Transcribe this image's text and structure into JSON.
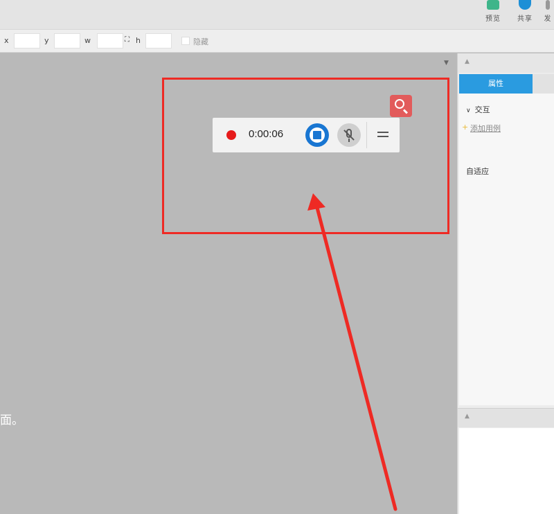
{
  "toolbar": {
    "preview_label": "预览",
    "share_label": "共享",
    "publish_label": "发"
  },
  "propbar": {
    "x_label": "x",
    "y_label": "y",
    "w_label": "w",
    "h_label": "h",
    "hidden_label": "隐藏"
  },
  "recorder": {
    "elapsed_time": "0:00:06"
  },
  "canvas": {
    "caption": "面。"
  },
  "inspector": {
    "tab_properties": "属性",
    "section_interaction": "交互",
    "add_case_link": "添加用例",
    "adaptive_label": "自适应"
  },
  "colors": {
    "highlight_red": "#ee2a24",
    "accent_blue": "#2a9be0",
    "record_red": "#e61b1b"
  }
}
